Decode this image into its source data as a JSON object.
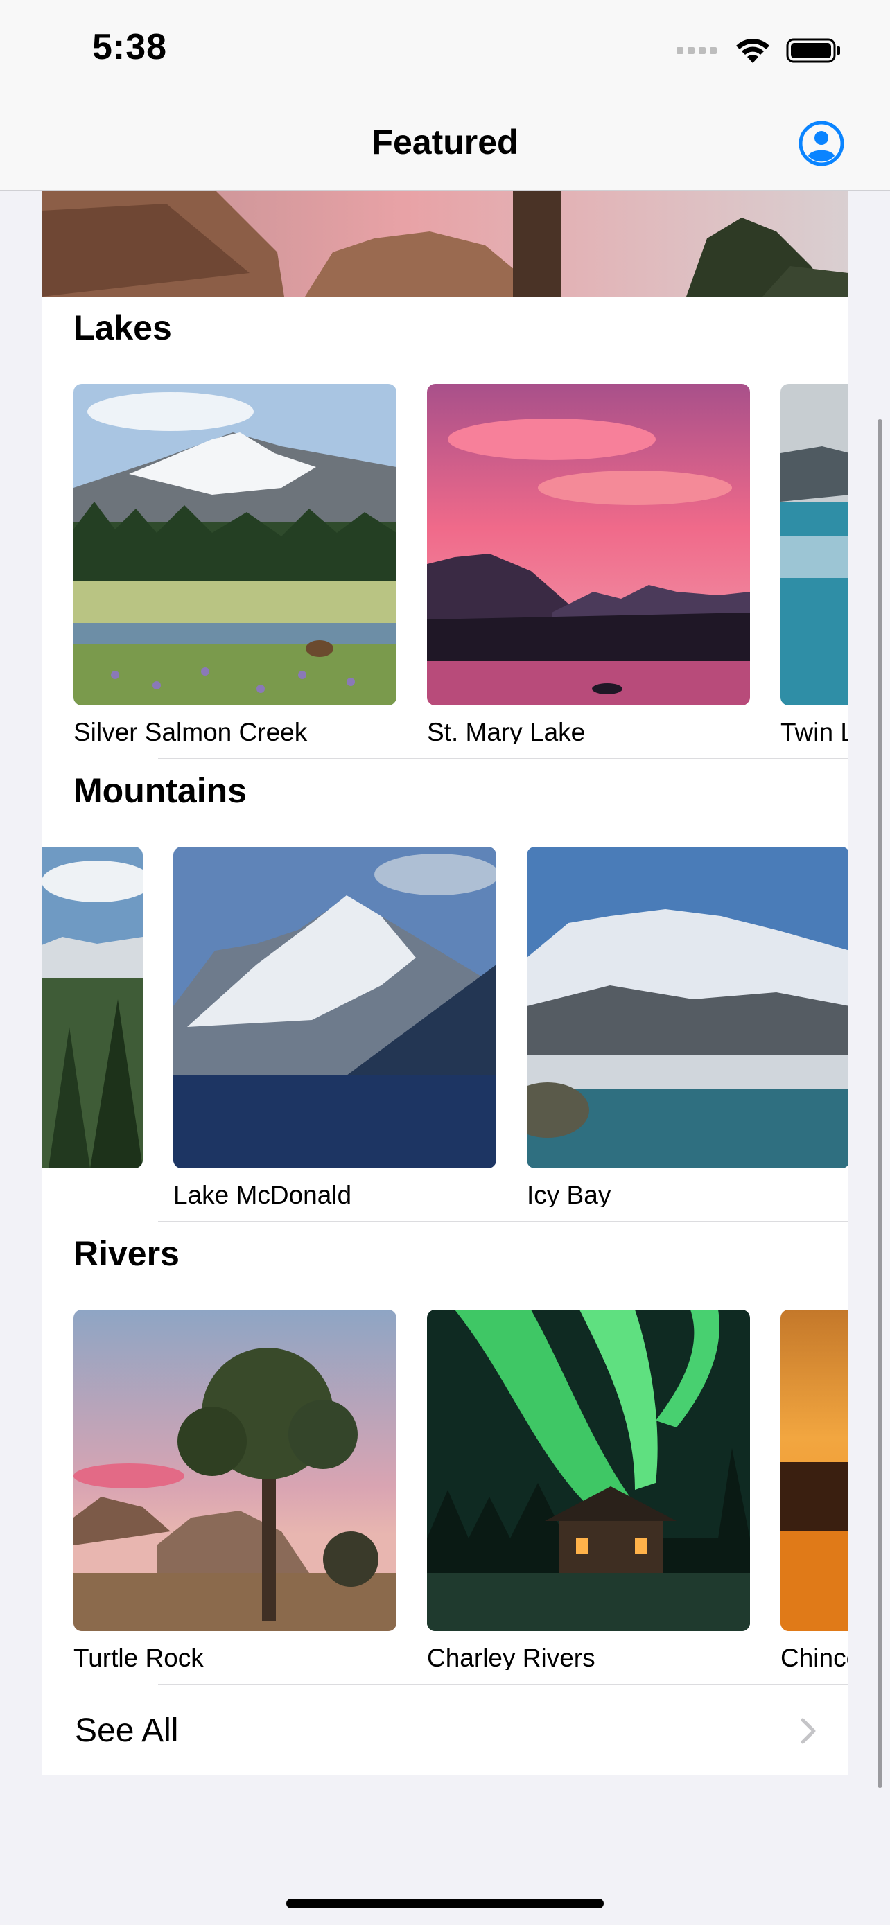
{
  "status_bar": {
    "time": "5:38"
  },
  "nav": {
    "title": "Featured",
    "profile_icon": "person-crop-circle-icon"
  },
  "sections": [
    {
      "title": "Lakes",
      "items": [
        {
          "label": "Silver Salmon Creek"
        },
        {
          "label": "St. Mary Lake"
        },
        {
          "label": "Twin L"
        }
      ]
    },
    {
      "title": "Mountains",
      "items": [
        {
          "label": ""
        },
        {
          "label": "Lake McDonald"
        },
        {
          "label": "Icy Bay"
        }
      ]
    },
    {
      "title": "Rivers",
      "items": [
        {
          "label": "Turtle Rock"
        },
        {
          "label": "Charley Rivers"
        },
        {
          "label": "Chinco"
        }
      ]
    }
  ],
  "see_all": {
    "label": "See All",
    "icon": "chevron-right-icon"
  },
  "colors": {
    "accent": "#0a84ff",
    "background": "#f2f2f7"
  }
}
